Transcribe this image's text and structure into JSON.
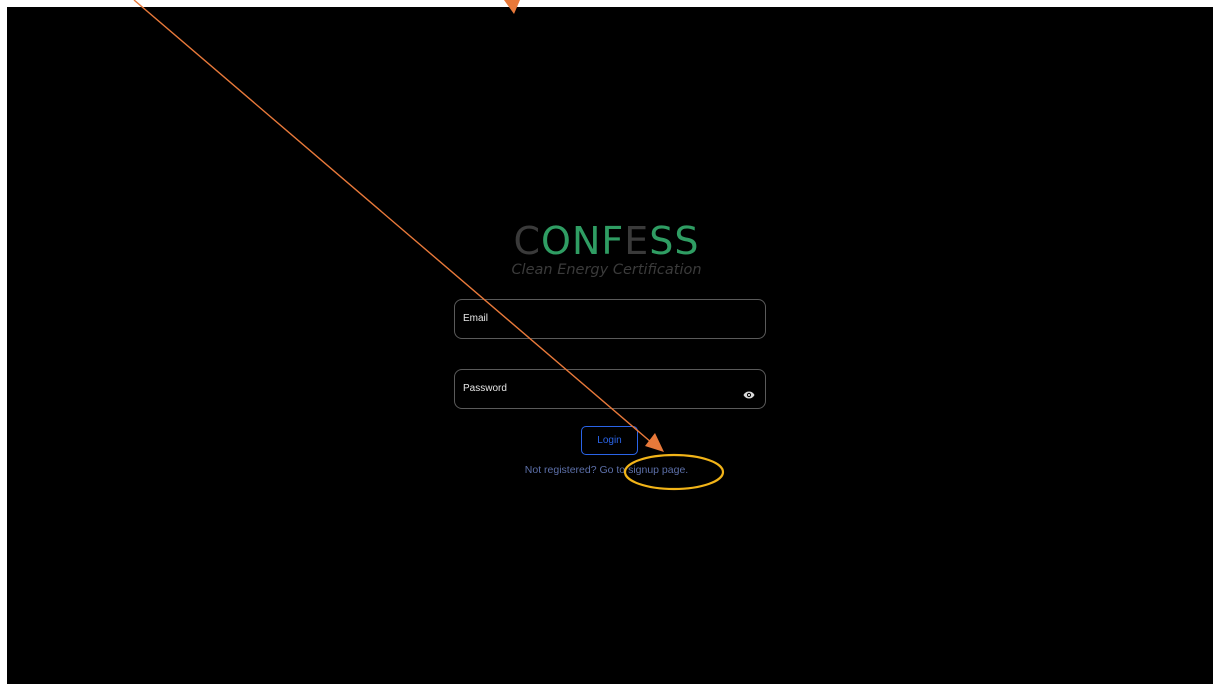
{
  "logo": {
    "letter_1": "C",
    "letters_2": "ONF",
    "letter_3": "E",
    "letters_4": "SS"
  },
  "tagline": "Clean Energy Certification",
  "form": {
    "email_label": "Email",
    "password_label": "Password",
    "login_label": "Login"
  },
  "signup": {
    "prefix": "Not registered? Go to ",
    "link_label": "signup page."
  },
  "icons": {
    "password_toggle": "eye-icon"
  },
  "colors": {
    "background": "#000000",
    "logo_green": "#2f9d63",
    "logo_dim": "#3a3a3a",
    "button_blue": "#2a64e8",
    "link_blue": "#5c6fa8",
    "annotation_arrow": "#e8793a",
    "annotation_highlight": "#f2b418"
  }
}
